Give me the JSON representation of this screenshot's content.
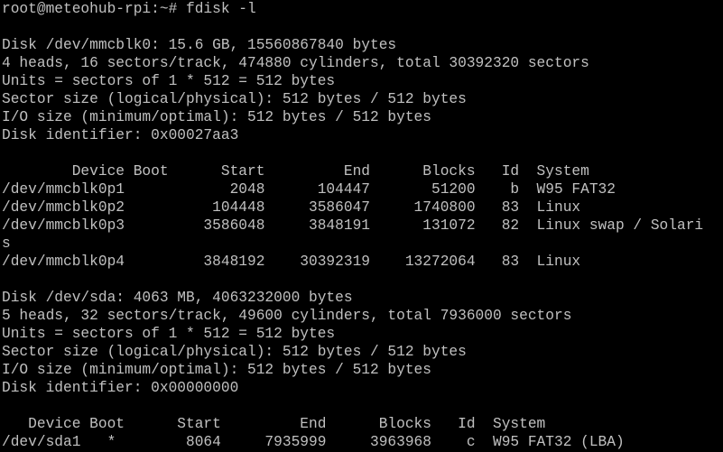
{
  "terminal": {
    "lines": [
      "root@meteohub-rpi:~# fdisk -l",
      "",
      "Disk /dev/mmcblk0: 15.6 GB, 15560867840 bytes",
      "4 heads, 16 sectors/track, 474880 cylinders, total 30392320 sectors",
      "Units = sectors of 1 * 512 = 512 bytes",
      "Sector size (logical/physical): 512 bytes / 512 bytes",
      "I/O size (minimum/optimal): 512 bytes / 512 bytes",
      "Disk identifier: 0x00027aa3",
      "",
      "        Device Boot      Start         End      Blocks   Id  System",
      "/dev/mmcblk0p1            2048      104447       51200    b  W95 FAT32",
      "/dev/mmcblk0p2          104448     3586047     1740800   83  Linux",
      "/dev/mmcblk0p3         3586048     3848191      131072   82  Linux swap / Solari",
      "s",
      "/dev/mmcblk0p4         3848192    30392319    13272064   83  Linux",
      "",
      "Disk /dev/sda: 4063 MB, 4063232000 bytes",
      "5 heads, 32 sectors/track, 49600 cylinders, total 7936000 sectors",
      "Units = sectors of 1 * 512 = 512 bytes",
      "Sector size (logical/physical): 512 bytes / 512 bytes",
      "I/O size (minimum/optimal): 512 bytes / 512 bytes",
      "Disk identifier: 0x00000000",
      "",
      "   Device Boot      Start         End      Blocks   Id  System",
      "/dev/sda1   *        8064     7935999     3963968    c  W95 FAT32 (LBA)"
    ]
  },
  "colors": {
    "background": "#000000",
    "text": "#c0c0c0"
  }
}
